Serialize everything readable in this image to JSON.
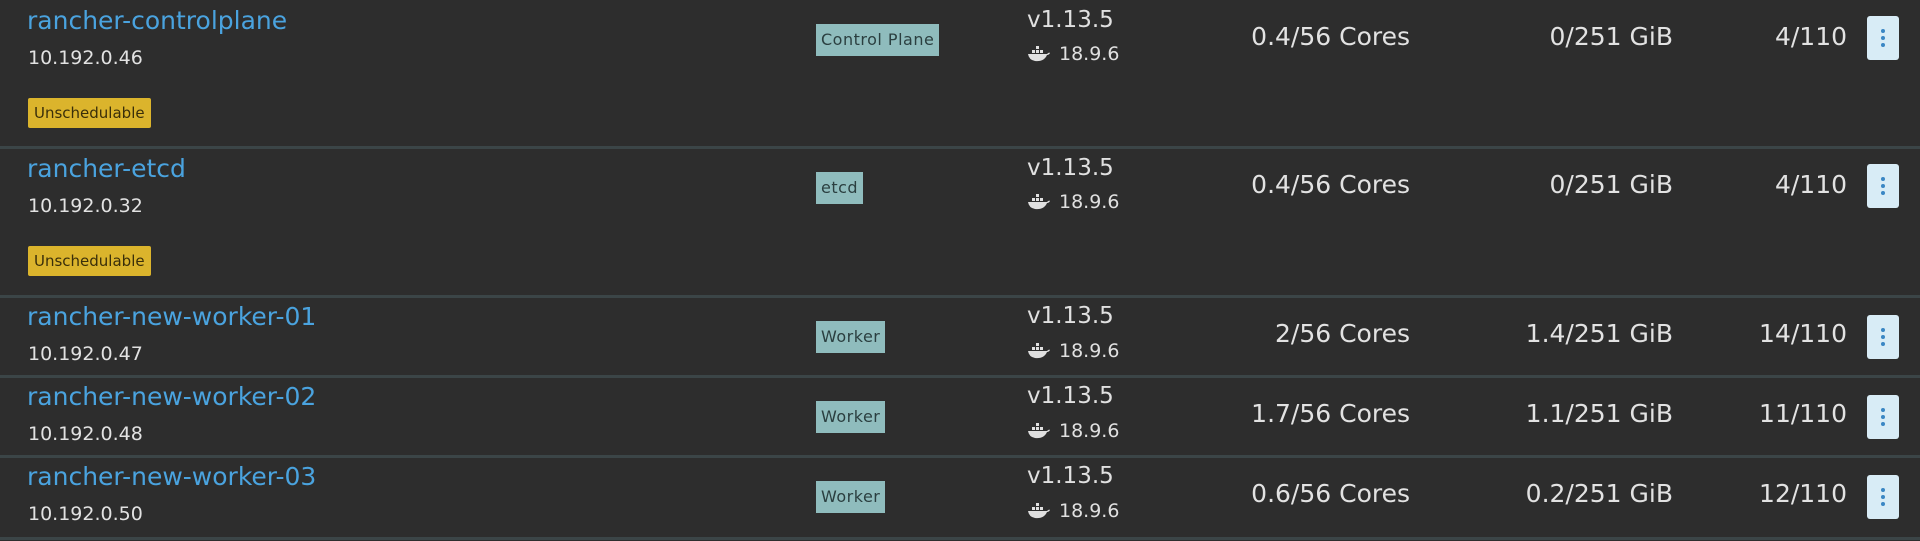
{
  "nodes": [
    {
      "name": "rancher-controlplane",
      "ip": "10.192.0.46",
      "badge": "Unschedulable",
      "role": "Control Plane",
      "k8s_version": "v1.13.5",
      "docker_version": "18.9.6",
      "cpu": "0.4/56 Cores",
      "memory": "0/251 GiB",
      "pods": "4/110"
    },
    {
      "name": "rancher-etcd",
      "ip": "10.192.0.32",
      "badge": "Unschedulable",
      "role": "etcd",
      "k8s_version": "v1.13.5",
      "docker_version": "18.9.6",
      "cpu": "0.4/56 Cores",
      "memory": "0/251 GiB",
      "pods": "4/110"
    },
    {
      "name": "rancher-new-worker-01",
      "ip": "10.192.0.47",
      "role": "Worker",
      "k8s_version": "v1.13.5",
      "docker_version": "18.9.6",
      "cpu": "2/56 Cores",
      "memory": "1.4/251 GiB",
      "pods": "14/110"
    },
    {
      "name": "rancher-new-worker-02",
      "ip": "10.192.0.48",
      "role": "Worker",
      "k8s_version": "v1.13.5",
      "docker_version": "18.9.6",
      "cpu": "1.7/56 Cores",
      "memory": "1.1/251 GiB",
      "pods": "11/110"
    },
    {
      "name": "rancher-new-worker-03",
      "ip": "10.192.0.50",
      "role": "Worker",
      "k8s_version": "v1.13.5",
      "docker_version": "18.9.6",
      "cpu": "0.6/56 Cores",
      "memory": "0.2/251 GiB",
      "pods": "12/110"
    }
  ],
  "icons": {
    "docker": "docker-whale-icon",
    "menu": "kebab-menu-icon"
  },
  "colors": {
    "link": "#4aa3df",
    "unschedulable": "#dbb42c",
    "role_badge": "#8fbcbd",
    "menu_button": "#d8ecf6"
  }
}
